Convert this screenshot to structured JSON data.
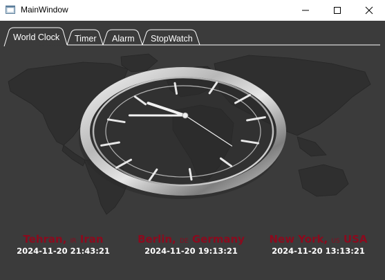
{
  "window": {
    "title": "MainWindow"
  },
  "tabs": [
    {
      "label": "World Clock",
      "active": true
    },
    {
      "label": "Timer",
      "active": false
    },
    {
      "label": "Alarm",
      "active": false
    },
    {
      "label": "StopWatch",
      "active": false
    }
  ],
  "clock": {
    "hour": 21,
    "minute": 43,
    "second": 21
  },
  "cities": [
    {
      "city": "Tehran,",
      "code": "IR",
      "country": "Iran",
      "datetime": "2024-11-20 21:43:21"
    },
    {
      "city": "Berlin,",
      "code": "DE",
      "country": "Germany",
      "datetime": "2024-11-20 19:13:21"
    },
    {
      "city": "New York,",
      "code": "US",
      "country": "USA",
      "datetime": "2024-11-20 13:13:21"
    }
  ],
  "colors": {
    "background": "#3b3b3b",
    "city_text": "#8a0b1e",
    "time_text": "#ffffff",
    "map": "#2e2e2e"
  }
}
